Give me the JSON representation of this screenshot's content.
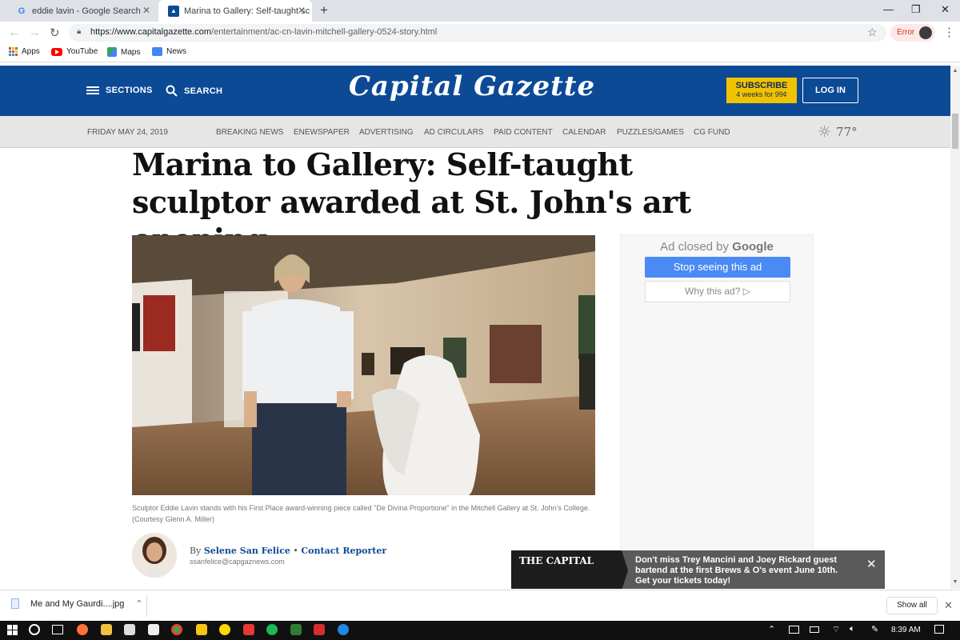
{
  "browser": {
    "tabs": [
      {
        "title": "eddie lavin - Google Search",
        "favicon": "google-g-icon"
      },
      {
        "title": "Marina to Gallery: Self-taught sc",
        "favicon": "capital-gazette-icon"
      }
    ],
    "url_host": "https://www.capitalgazette.com",
    "url_path": "/entertainment/ac-cn-lavin-mitchell-gallery-0524-story.html",
    "profile_status": "Error",
    "bookmarks": [
      {
        "label": "Apps",
        "icon": "apps-grid-icon"
      },
      {
        "label": "YouTube",
        "icon": "youtube-icon"
      },
      {
        "label": "Maps",
        "icon": "maps-icon"
      },
      {
        "label": "News",
        "icon": "news-icon"
      }
    ]
  },
  "site": {
    "sections_label": "SECTIONS",
    "search_label": "SEARCH",
    "logo_text": "Capital Gazette",
    "subscribe_label": "SUBSCRIBE",
    "subscribe_offer": "4 weeks for 99¢",
    "login_label": "LOG IN",
    "date": "FRIDAY MAY 24, 2019",
    "nav": [
      "BREAKING NEWS",
      "ENEWSPAPER",
      "ADVERTISING",
      "AD CIRCULARS",
      "PAID CONTENT",
      "CALENDAR",
      "PUZZLES/GAMES",
      "CG FUND"
    ],
    "temperature": "77°"
  },
  "article": {
    "headline": "Marina to Gallery: Self-taught sculptor awarded at St. John's art opening",
    "caption": "Sculptor Eddie Lavin stands with his First Place award-winning piece called \"De Divina Proportione\" in the Mitchell Gallery at St. John's College. (Courtesy Glenn A. Miller)",
    "byline_prefix": "By",
    "author": "Selene San Felice",
    "separator": "•",
    "contact_label": "Contact Reporter",
    "author_email": "ssanfelice@capgaznews.com"
  },
  "ad": {
    "closed_by": "Ad closed by",
    "google": "Google",
    "stop_label": "Stop seeing this ad",
    "why_label": "Why this ad?"
  },
  "promo": {
    "brand": "THE CAPITAL",
    "text": "Don't miss Trey Mancini and Joey Rickard guest bartend at the first Brews & O's event June 10th. Get your tickets today!"
  },
  "downloads": {
    "file": "Me and My Gaurdi....jpg",
    "show_all": "Show all"
  },
  "taskbar": {
    "time": "8:39 AM"
  },
  "colors": {
    "header_blue": "#0c4a96",
    "subscribe_yellow": "#f2c200",
    "ad_button_blue": "#4a8af4"
  }
}
